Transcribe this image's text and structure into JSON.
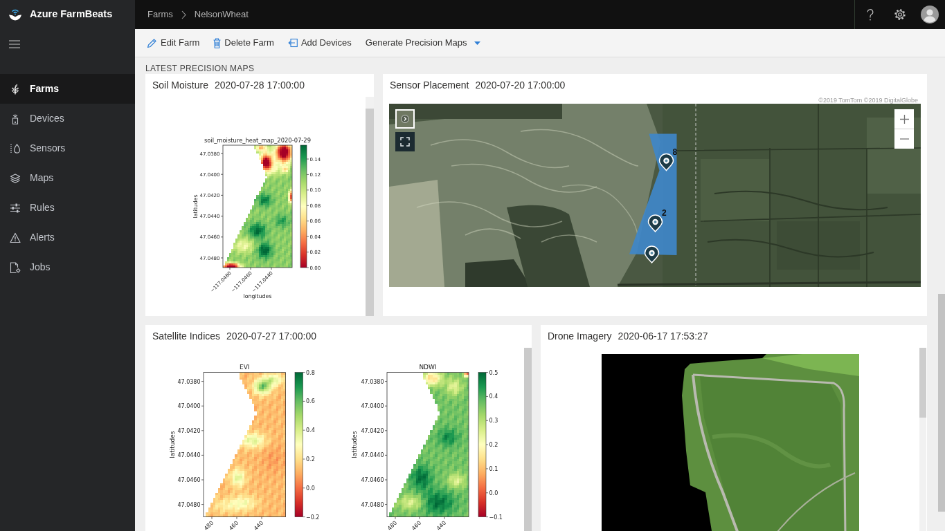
{
  "app": {
    "title": "Azure FarmBeats"
  },
  "sidebar": {
    "items": [
      {
        "label": "Farms",
        "selected": true
      },
      {
        "label": "Devices",
        "selected": false
      },
      {
        "label": "Sensors",
        "selected": false
      },
      {
        "label": "Maps",
        "selected": false
      },
      {
        "label": "Rules",
        "selected": false
      },
      {
        "label": "Alerts",
        "selected": false
      },
      {
        "label": "Jobs",
        "selected": false
      }
    ]
  },
  "breadcrumb": [
    "Farms",
    "NelsonWheat"
  ],
  "toolbar": [
    {
      "label": "Edit Farm",
      "kind": "button"
    },
    {
      "label": "Delete Farm",
      "kind": "button"
    },
    {
      "label": "Add Devices",
      "kind": "button"
    },
    {
      "label": "Generate Precision Maps",
      "kind": "dropdown"
    }
  ],
  "section_heading": "LATEST PRECISION MAPS",
  "cards": [
    {
      "kind": "heatmaps",
      "title": "Soil Moisture",
      "timestamp": "2020-07-28 17:00:00",
      "plots": [
        {
          "title": "soil_moisture_heat_map_2020-07-29",
          "ylabel": "latitudes",
          "xlabel": "longitudes",
          "yticks": [
            "47.0380",
            "47.0400",
            "47.0420",
            "47.0440",
            "47.0460",
            "47.0480"
          ],
          "xticks": [
            "−117.0480",
            "−117.0460",
            "−117.0440"
          ],
          "colorbar_ticks": [
            "0.14",
            "0.12",
            "0.10",
            "0.08",
            "0.06",
            "0.04",
            "0.02",
            "0.00"
          ]
        }
      ]
    },
    {
      "kind": "map",
      "title": "Sensor Placement",
      "timestamp": "2020-07-20 17:00:00",
      "attribution": "©2019 TomTom ©2019 DigitalGlobe",
      "pins": [
        {
          "kind": "numbered",
          "label": "8"
        },
        {
          "kind": "numbered",
          "label": "2"
        },
        {
          "kind": "plain"
        }
      ]
    },
    {
      "kind": "heatmaps",
      "title": "Satellite Indices",
      "timestamp": "2020-07-27 17:00:00",
      "plots": [
        {
          "title": "EVI",
          "ylabel": "latitudes",
          "yticks": [
            "47.0380",
            "47.0400",
            "47.0420",
            "47.0440",
            "47.0460",
            "47.0480"
          ],
          "xticks": [
            "480",
            "460",
            "440"
          ],
          "colorbar_ticks": [
            "0.8",
            "0.6",
            "0.4",
            "0.2",
            "0.0",
            "−0.2"
          ]
        },
        {
          "title": "NDWI",
          "ylabel": "latitudes",
          "yticks": [
            "47.0380",
            "47.0400",
            "47.0420",
            "47.0440",
            "47.0460",
            "47.0480"
          ],
          "xticks": [
            "480",
            "460",
            "440"
          ],
          "colorbar_ticks": [
            "0.5",
            "0.4",
            "0.3",
            "0.2",
            "0.1",
            "0.0",
            "−0.1"
          ]
        }
      ]
    },
    {
      "kind": "photo",
      "title": "Drone Imagery",
      "timestamp": "2020-06-17 17:53:27"
    }
  ]
}
